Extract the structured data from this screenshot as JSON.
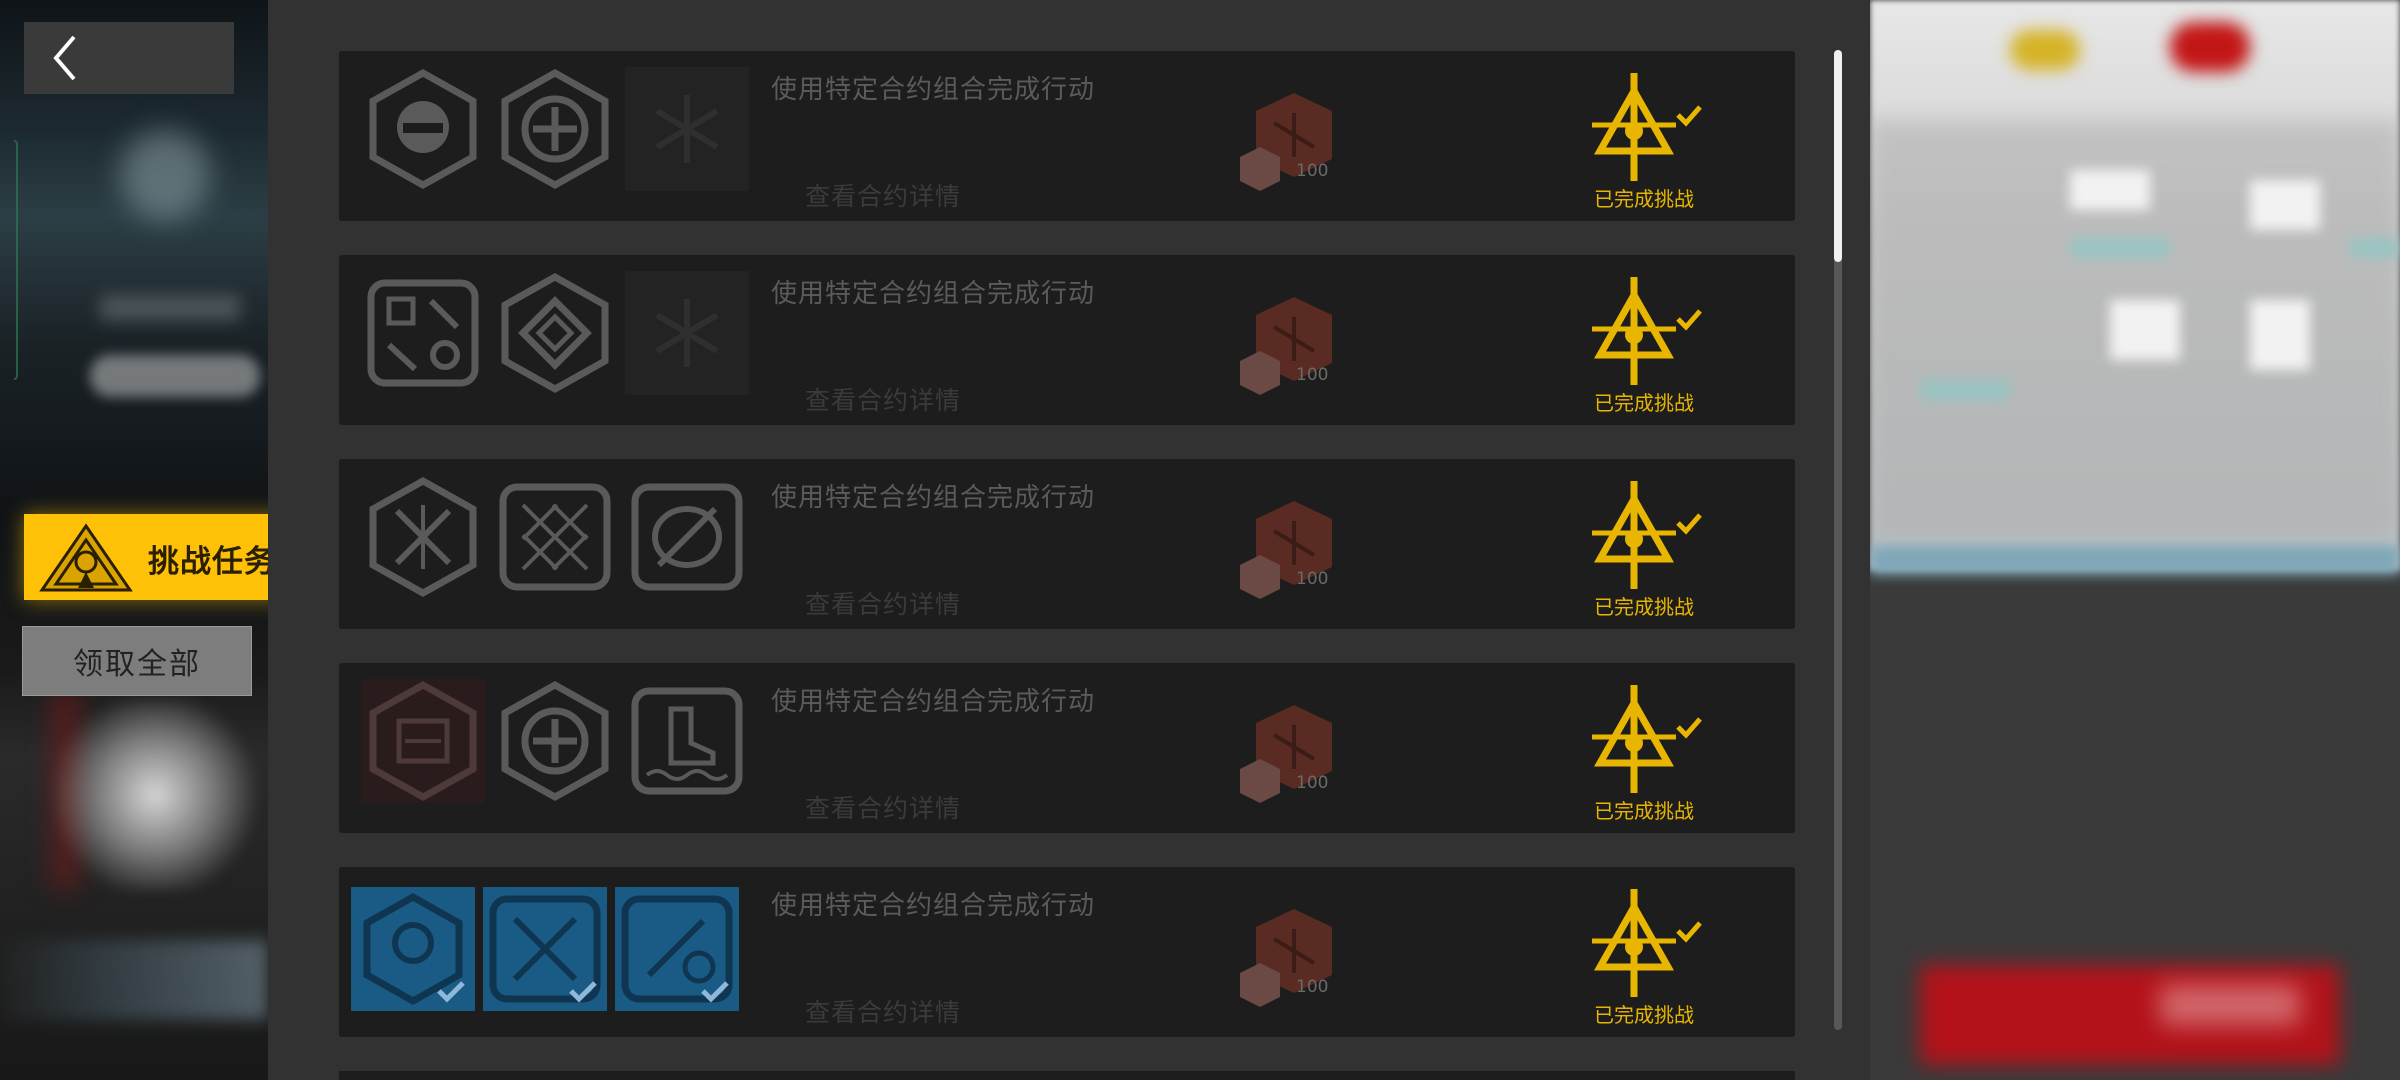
{
  "nav": {
    "back_icon": "chevron-left-icon",
    "challenge_tab_label": "挑战任务",
    "claim_all_label": "领取全部"
  },
  "colors": {
    "accent": "#ffc107",
    "panel_bg": "#323233",
    "card_bg": "#1d1d1d",
    "done_text": "#e8b600",
    "completed_icon_bg": "#1a5b86"
  },
  "cards": [
    {
      "title": "使用特定合约组合完成行动",
      "detail": "查看合约详情",
      "reward_count": "100",
      "status": "已完成挑战",
      "icons": [
        "helmet-contract-icon",
        "crosshair-contract-icon",
        "dim-snowflake-contract-icon"
      ]
    },
    {
      "title": "使用特定合约组合完成行动",
      "detail": "查看合约详情",
      "reward_count": "100",
      "status": "已完成挑战",
      "icons": [
        "tools-contract-icon",
        "diamond-contract-icon",
        "dim-snowflake-contract-icon"
      ]
    },
    {
      "title": "使用特定合约组合完成行动",
      "detail": "查看合约详情",
      "reward_count": "100",
      "status": "已完成挑战",
      "icons": [
        "broken-arrows-contract-icon",
        "grid-contract-icon",
        "shield-slash-contract-icon"
      ]
    },
    {
      "title": "使用特定合约组合完成行动",
      "detail": "查看合约详情",
      "reward_count": "100",
      "status": "已完成挑战",
      "icons": [
        "contract-text-icon",
        "crosshair-contract-icon",
        "boot-water-contract-icon"
      ]
    },
    {
      "title": "使用特定合约组合完成行动",
      "detail": "查看合约详情",
      "reward_count": "100",
      "status": "已完成挑战",
      "icons": [
        "emblem-check-icon",
        "swords-check-icon",
        "sword-clock-check-icon"
      ]
    }
  ]
}
